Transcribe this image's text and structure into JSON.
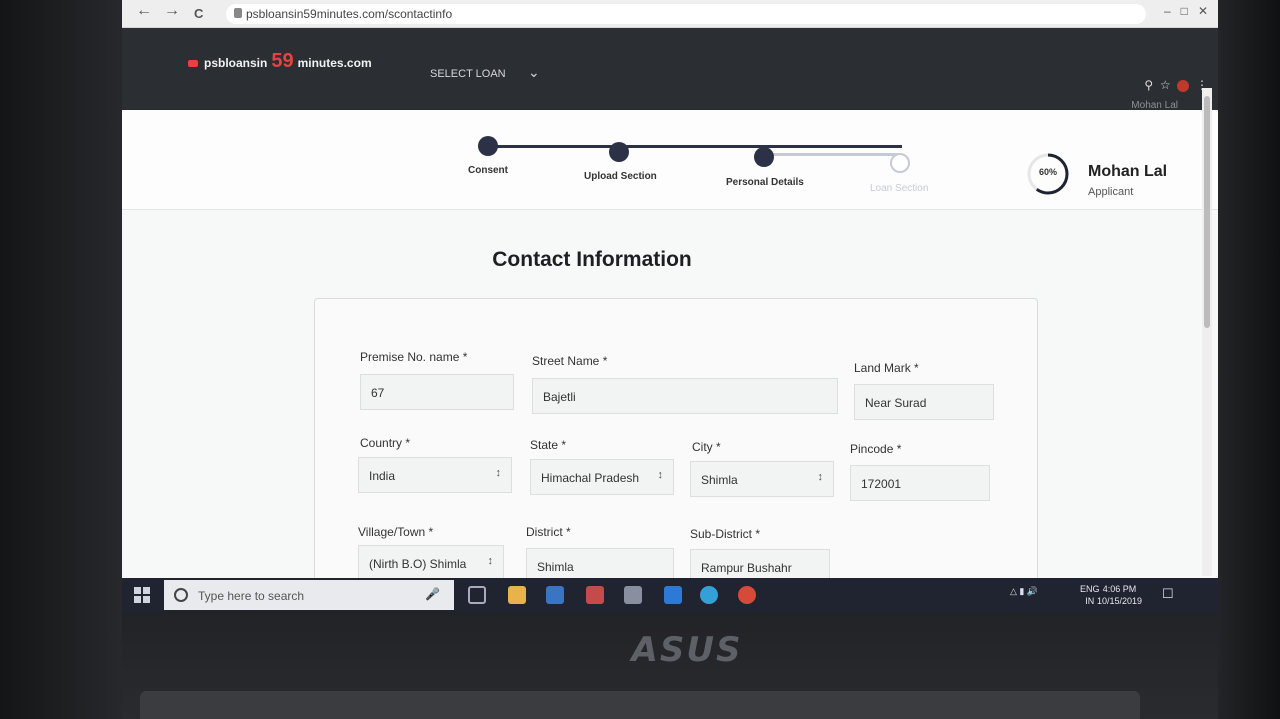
{
  "browser": {
    "url": "psbloansin59minutes.com/scontactinfo",
    "back": "←",
    "forward": "→",
    "reload": "C"
  },
  "header": {
    "brand_left": "psbloansin",
    "brand_num": "59",
    "brand_right": "minutes.com",
    "select_loan": "SELECT LOAN",
    "user_short": "Mohan Lal"
  },
  "steps": [
    {
      "label": "Consent",
      "done": true
    },
    {
      "label": "Upload Section",
      "done": true
    },
    {
      "label": "Personal Details",
      "done": true
    },
    {
      "label": "Loan Section",
      "done": false
    }
  ],
  "profile": {
    "progress": 60,
    "progress_label": "60%",
    "name": "Mohan Lal",
    "role": "Applicant"
  },
  "page": {
    "title": "Contact Information"
  },
  "form": {
    "premise_label": "Premise No. name *",
    "premise_value": "67",
    "street_label": "Street Name *",
    "street_value": "Bajetli",
    "landmark_label": "Land Mark *",
    "landmark_value": "Near Surad",
    "country_label": "Country *",
    "country_value": "India",
    "state_label": "State *",
    "state_value": "Himachal Pradesh",
    "city_label": "City *",
    "city_value": "Shimla",
    "pincode_label": "Pincode *",
    "pincode_value": "172001",
    "village_label": "Village/Town *",
    "village_value": "(Nirth B.O) Shimla",
    "district_label": "District *",
    "district_value": "Shimla",
    "subdistrict_label": "Sub-District *",
    "subdistrict_value": "Rampur Bushahr"
  },
  "taskbar": {
    "search_placeholder": "Type here to search",
    "lang": "ENG",
    "lang2": "IN",
    "time": "4:06 PM",
    "date": "10/15/2019"
  },
  "device": {
    "logo": "ASUS"
  },
  "colors": {
    "header_bg": "#2b2e33",
    "step_active": "#2c3147",
    "brand_red": "#e84141"
  }
}
